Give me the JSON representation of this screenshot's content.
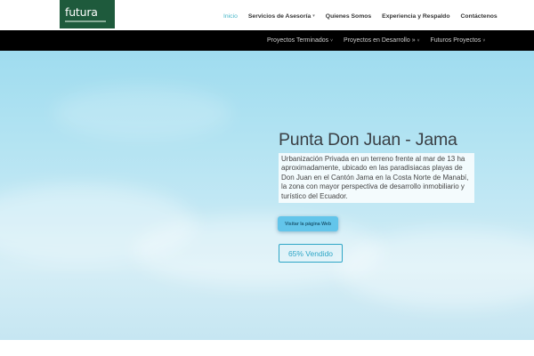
{
  "header": {
    "logo_text": "futura",
    "nav": [
      {
        "label": "Inicio",
        "active": true,
        "has_dropdown": false
      },
      {
        "label": "Servicios de Asesoría",
        "active": false,
        "has_dropdown": true
      },
      {
        "label": "Quienes Somos",
        "active": false,
        "has_dropdown": false
      },
      {
        "label": "Experiencia y Respaldo",
        "active": false,
        "has_dropdown": false
      },
      {
        "label": "Contáctenos",
        "active": false,
        "has_dropdown": false
      }
    ],
    "dropdown_caret": "▾"
  },
  "subnav": {
    "items": [
      {
        "label": "Proyectos Terminados",
        "suffix": "˅"
      },
      {
        "label": "Proyectos en Desarrollo »",
        "suffix": "˅"
      },
      {
        "label": "Futuros Proyectos",
        "suffix": "˅"
      }
    ]
  },
  "hero": {
    "title": "Punta Don Juan - Jama",
    "description": "Urbanización Privada en un terreno frente al mar de 13 ha aproximadamente, ubicado en las paradisiacas playas de Don Juan en el Cantón Jama en la Costa Norte de Manabí, la zona con mayor perspectiva de desarrollo inmobiliario y turístico del Ecuador.",
    "visit_button_label": "Visitar la página Web",
    "sold_badge": "65% Vendido",
    "sold_percent": 65
  },
  "colors": {
    "brand_green": "#1e5a3c",
    "accent_teal": "#48b7c8",
    "button_blue": "#63c5ea",
    "subbar_black": "#000000"
  }
}
